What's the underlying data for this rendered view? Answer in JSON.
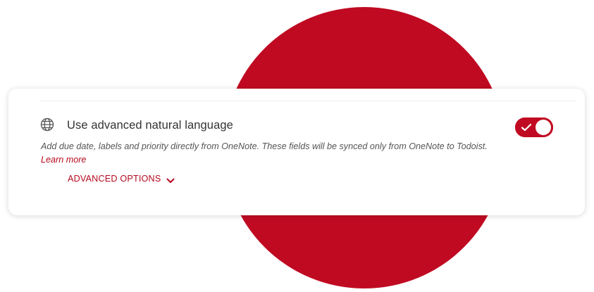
{
  "setting": {
    "title": "Use advanced natural language",
    "icon": "globe-icon",
    "enabled": true,
    "description": "Add due date, labels and priority directly from OneNote. These fields will be synced only from OneNote to Todoist.",
    "learn_more": "Learn more",
    "advanced_options_label": "ADVANCED OPTIONS"
  },
  "colors": {
    "accent": "#c00a22",
    "text": "#333333",
    "muted": "#555555"
  }
}
